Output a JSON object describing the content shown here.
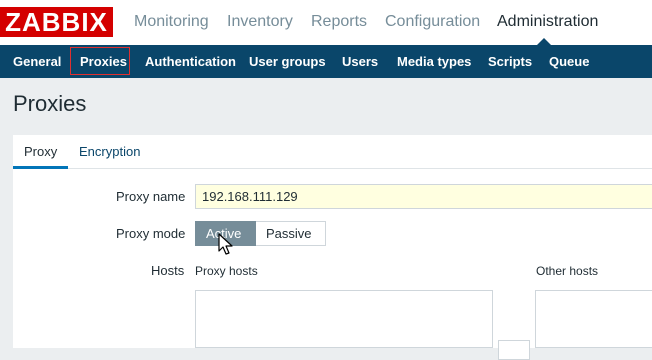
{
  "brand": {
    "logo_text": "ZABBIX",
    "logo_color": "#d40000"
  },
  "main_menu": {
    "items": [
      {
        "label": "Monitoring"
      },
      {
        "label": "Inventory"
      },
      {
        "label": "Reports"
      },
      {
        "label": "Configuration"
      },
      {
        "label": "Administration"
      }
    ],
    "selected": "Administration"
  },
  "sub_nav": {
    "items": [
      {
        "label": "General"
      },
      {
        "label": "Proxies"
      },
      {
        "label": "Authentication"
      },
      {
        "label": "User groups"
      },
      {
        "label": "Users"
      },
      {
        "label": "Media types"
      },
      {
        "label": "Scripts"
      },
      {
        "label": "Queue"
      }
    ],
    "selected": "Proxies",
    "background_color": "#0a466a"
  },
  "page": {
    "title": "Proxies"
  },
  "form_tabs": {
    "items": [
      {
        "label": "Proxy"
      },
      {
        "label": "Encryption"
      }
    ],
    "active": "Proxy"
  },
  "form": {
    "proxy_name": {
      "label": "Proxy name",
      "value": "192.168.111.129"
    },
    "proxy_mode": {
      "label": "Proxy mode",
      "options": [
        {
          "label": "Active"
        },
        {
          "label": "Passive"
        }
      ],
      "selected": "Active"
    },
    "hosts": {
      "label": "Hosts",
      "proxy_hosts_header": "Proxy hosts",
      "other_hosts_header": "Other hosts"
    }
  }
}
